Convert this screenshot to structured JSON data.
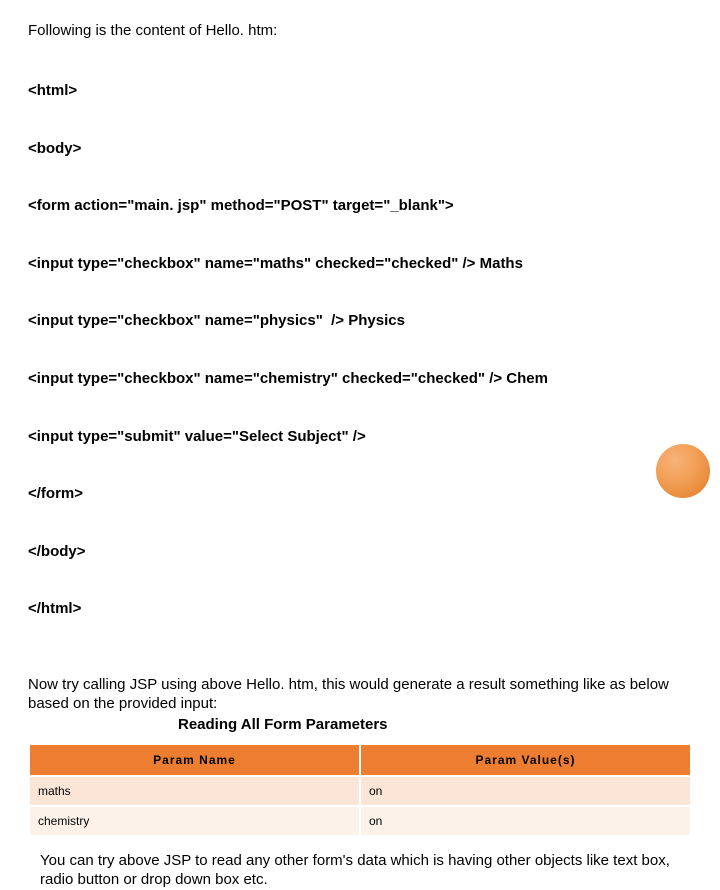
{
  "intro": "Following is the content of Hello. htm:",
  "code_lines": [
    "<html>",
    "<body>",
    "<form action=\"main. jsp\" method=\"POST\" target=\"_blank\">",
    "<input type=\"checkbox\" name=\"maths\" checked=\"checked\" /> Maths",
    "<input type=\"checkbox\" name=\"physics\"  /> Physics",
    "<input type=\"checkbox\" name=\"chemistry\" checked=\"checked\" /> Chem",
    "<input type=\"submit\" value=\"Select Subject\" />",
    "</form>",
    "</body>",
    "</html>"
  ],
  "after": "Now try calling JSP using above Hello. htm, this would generate a result something like as below based on the provided input:",
  "heading": "Reading All Form Parameters",
  "table": {
    "headers": [
      "Param Name",
      "Param Value(s)"
    ],
    "rows": [
      [
        "maths",
        "on"
      ],
      [
        "chemistry",
        "on"
      ]
    ]
  },
  "closing": "You can try above JSP to read any other form's data which is having other objects like text box, radio button or drop down box etc."
}
